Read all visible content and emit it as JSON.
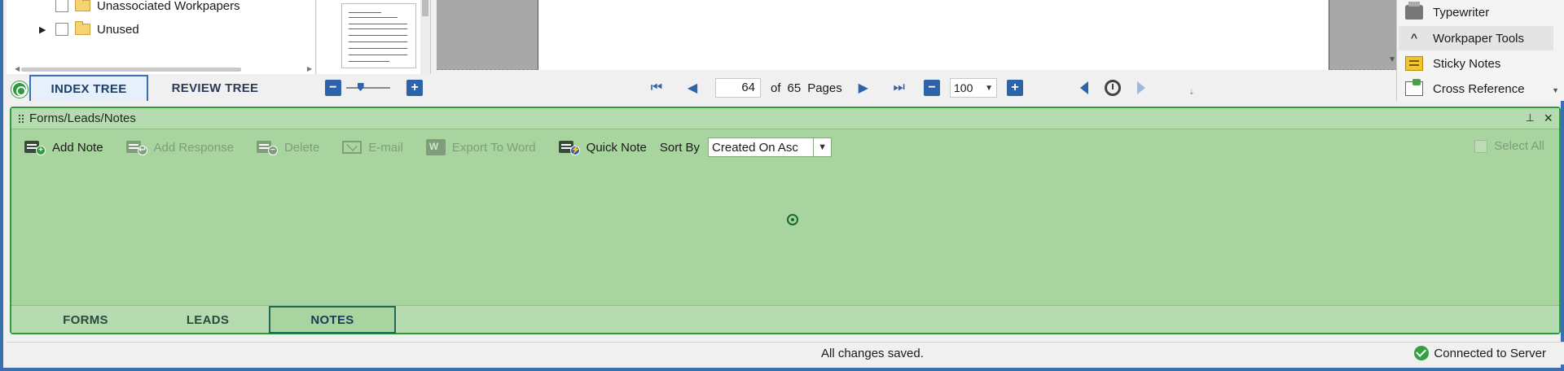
{
  "index_tree": {
    "items": [
      {
        "label": "Unassociated Workpapers"
      },
      {
        "label": "Unused"
      }
    ],
    "tabs": [
      {
        "label": "INDEX TREE",
        "active": true
      },
      {
        "label": "REVIEW TREE",
        "active": false
      }
    ]
  },
  "thumbnails": {
    "zoom_out_symbol": "−",
    "zoom_in_symbol": "+"
  },
  "pager": {
    "current_page": "64",
    "of_label": "of",
    "total_pages": "65",
    "pages_label": "Pages",
    "zoom_out_symbol": "−",
    "zoom_value": "100",
    "zoom_in_symbol": "+"
  },
  "tools_panel": {
    "items": [
      {
        "label": "Typewriter",
        "icon": "typewriter-icon"
      },
      {
        "label": "Workpaper Tools",
        "icon": "chevron-up-icon",
        "highlighted": true
      },
      {
        "label": "Sticky Notes",
        "icon": "sticky-notes-icon"
      },
      {
        "label": "Cross Reference",
        "icon": "cross-reference-icon"
      }
    ]
  },
  "notes_panel": {
    "title": "Forms/Leads/Notes",
    "pin_symbol": "📌",
    "close_symbol": "×",
    "toolbar": {
      "add_note": "Add Note",
      "add_response": "Add Response",
      "delete": "Delete",
      "email": "E-mail",
      "export_to_word": "Export To Word",
      "quick_note": "Quick Note",
      "sort_by_label": "Sort By",
      "sort_by_value": "Created On Asc",
      "select_all": "Select All"
    },
    "bottom_tabs": [
      {
        "label": "FORMS",
        "active": false
      },
      {
        "label": "LEADS",
        "active": false
      },
      {
        "label": "NOTES",
        "active": true
      }
    ]
  },
  "status_bar": {
    "message": "All changes saved.",
    "connection": "Connected to Server"
  },
  "colors": {
    "accent_blue": "#2d63a8",
    "panel_green": "#a8d4a0",
    "panel_border_green": "#2e9a3c",
    "status_ok": "#35a043"
  }
}
